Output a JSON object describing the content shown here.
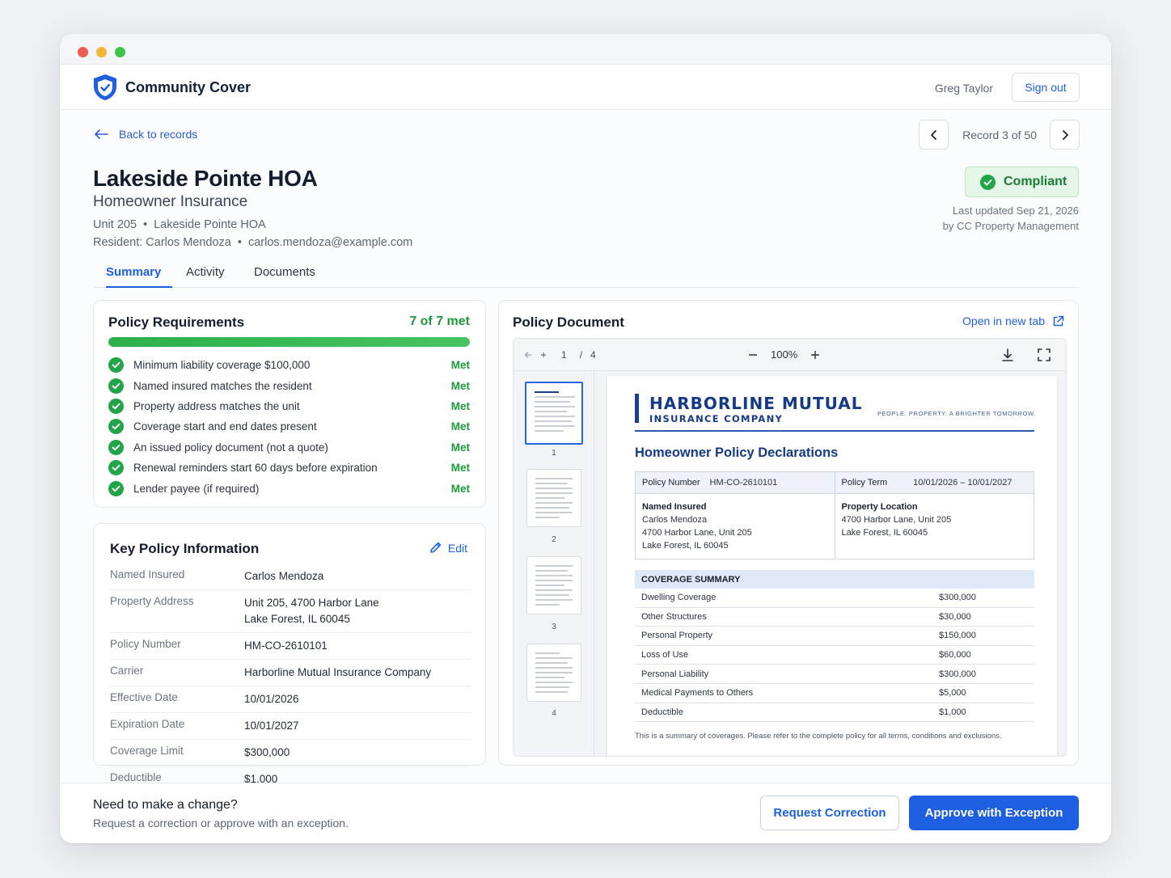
{
  "app": {
    "brand": "Community Cover",
    "user": "Greg Taylor",
    "sign_out": "Sign out",
    "accent": "#1d5fe0"
  },
  "nav": {
    "back": "Back to records",
    "record_position": "Record 3 of 50"
  },
  "record": {
    "title": "Lakeside Pointe HOA",
    "subtitle": "Homeowner Insurance",
    "unit": "Unit 205",
    "community": "Lakeside Pointe HOA",
    "resident": "Resident: Carlos Mendoza",
    "email": "carlos.mendoza@example.com",
    "status": "Compliant",
    "status_color": "#1b7a33",
    "updated_line1": "Last updated Sep 21, 2026",
    "updated_line2": "by CC Property Management"
  },
  "tabs": [
    "Summary",
    "Activity",
    "Documents"
  ],
  "requirements": {
    "title": "Policy Requirements",
    "summary": "7 of 7 met",
    "progress_fraction": 1.0,
    "items": [
      {
        "label": "Minimum liability coverage $100,000",
        "status": "Met"
      },
      {
        "label": "Named insured matches the resident",
        "status": "Met"
      },
      {
        "label": "Property address matches the unit",
        "status": "Met"
      },
      {
        "label": "Coverage start and end dates present",
        "status": "Met"
      },
      {
        "label": "An issued policy document (not a quote)",
        "status": "Met"
      },
      {
        "label": "Renewal reminders start 60 days before expiration",
        "status": "Met"
      },
      {
        "label": "Lender payee (if required)",
        "status": "Met"
      }
    ]
  },
  "key_info": {
    "title": "Key Policy Information",
    "edit": "Edit",
    "rows": [
      {
        "key": "Named Insured",
        "value": "Carlos Mendoza"
      },
      {
        "key": "Property Address",
        "value": "Unit 205, 4700 Harbor Lane",
        "value2": "Lake Forest, IL 60045"
      },
      {
        "key": "Policy Number",
        "value": "HM-CO-2610101"
      },
      {
        "key": "Carrier",
        "value": "Harborline Mutual Insurance Company"
      },
      {
        "key": "Effective Date",
        "value": "10/01/2026"
      },
      {
        "key": "Expiration Date",
        "value": "10/01/2027"
      },
      {
        "key": "Coverage Limit",
        "value": "$300,000"
      },
      {
        "key": "Deductible",
        "value": "$1,000"
      }
    ]
  },
  "document": {
    "title": "Policy Document",
    "open_new_tab": "Open in new tab",
    "page_current": "1",
    "page_sep": "/",
    "page_total": "4",
    "zoom": "100%",
    "thumb_numbers": [
      "1",
      "2",
      "3",
      "4"
    ],
    "page": {
      "company": "HARBORLINE MUTUAL",
      "company_sub": "INSURANCE COMPANY",
      "tagline": "PEOPLE. PROPERTY. A BRIGHTER TOMORROW.",
      "heading": "Homeowner Policy Declarations",
      "policy_number_label": "Policy Number",
      "policy_number": "HM-CO-2610101",
      "policy_term_label": "Policy Term",
      "policy_term": "10/01/2026 – 10/01/2027",
      "named_insured_label": "Named Insured",
      "named_insured_lines": [
        "Carlos Mendoza",
        "4700 Harbor Lane, Unit 205",
        "Lake Forest, IL 60045"
      ],
      "property_location_label": "Property Location",
      "property_location_lines": [
        "4700 Harbor Lane, Unit 205",
        "Lake Forest, IL 60045"
      ],
      "coverage_header": "COVERAGE SUMMARY",
      "coverages": [
        {
          "label": "Dwelling Coverage",
          "value": "$300,000"
        },
        {
          "label": "Other Structures",
          "value": "$30,000"
        },
        {
          "label": "Personal Property",
          "value": "$150,000"
        },
        {
          "label": "Loss of Use",
          "value": "$60,000"
        },
        {
          "label": "Personal Liability",
          "value": "$300,000"
        },
        {
          "label": "Medical Payments to Others",
          "value": "$5,000"
        },
        {
          "label": "Deductible",
          "value": "$1,000"
        }
      ],
      "note": "This is a summary of coverages. Please refer to the complete policy for all terms, conditions and exclusions."
    }
  },
  "footer": {
    "title": "Need to make a change?",
    "subtitle": "Request a correction or approve with an exception.",
    "request_correction": "Request Correction",
    "approve_exception": "Approve with Exception"
  }
}
